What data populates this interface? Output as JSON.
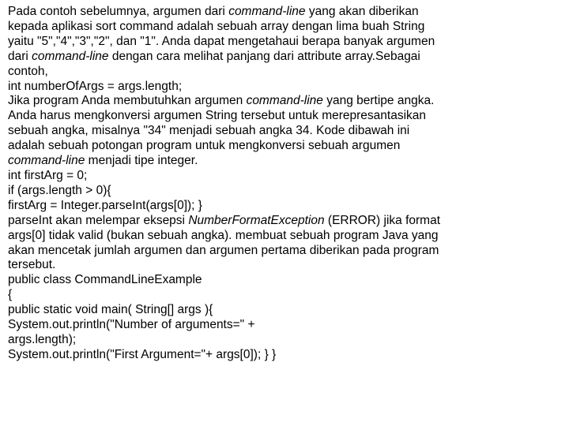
{
  "lines": [
    {
      "t": "p",
      "segments": [
        {
          "text": "Pada contoh sebelumnya, argumen dari "
        },
        {
          "text": "command-line",
          "ital": true
        },
        {
          "text": " yang akan diberikan"
        }
      ]
    },
    {
      "t": "p",
      "segments": [
        {
          "text": "kepada aplikasi sort command adalah sebuah array dengan lima buah String"
        }
      ]
    },
    {
      "t": "p",
      "segments": [
        {
          "text": "yaitu \"5\",\"4\",\"3\",\"2\", dan \"1\". Anda dapat mengetahaui berapa banyak argumen"
        }
      ]
    },
    {
      "t": "p",
      "segments": [
        {
          "text": "dari "
        },
        {
          "text": "command-line",
          "ital": true
        },
        {
          "text": " dengan cara melihat panjang dari attribute array.Sebagai"
        }
      ]
    },
    {
      "t": "p",
      "segments": [
        {
          "text": "contoh,"
        }
      ]
    },
    {
      "t": "p",
      "segments": [
        {
          "text": "int numberOfArgs = args.length;"
        }
      ]
    },
    {
      "t": "p",
      "segments": [
        {
          "text": "Jika program Anda membutuhkan argumen "
        },
        {
          "text": "command-line",
          "ital": true
        },
        {
          "text": " yang bertipe angka."
        }
      ]
    },
    {
      "t": "p",
      "segments": [
        {
          "text": "Anda harus mengkonversi argumen String tersebut untuk merepresantasikan"
        }
      ]
    },
    {
      "t": "p",
      "segments": [
        {
          "text": "sebuah angka, misalnya \"34\" menjadi sebuah angka 34. Kode dibawah ini"
        }
      ]
    },
    {
      "t": "p",
      "segments": [
        {
          "text": "adalah sebuah potongan program untuk mengkonversi sebuah argumen"
        }
      ]
    },
    {
      "t": "p",
      "segments": [
        {
          "text": "command-line",
          "ital": true
        },
        {
          "text": " menjadi tipe integer."
        }
      ]
    },
    {
      "t": "p",
      "segments": [
        {
          "text": "int firstArg = 0;"
        }
      ]
    },
    {
      "t": "p",
      "segments": [
        {
          "text": "if (args.length > 0){"
        }
      ]
    },
    {
      "t": "p",
      "segments": [
        {
          "text": "firstArg = Integer.parseInt(args[0]); }"
        }
      ]
    },
    {
      "t": "p",
      "segments": [
        {
          "text": "parseInt akan melempar eksepsi "
        },
        {
          "text": "NumberFormatException",
          "ital": true
        },
        {
          "text": " (ERROR) jika format"
        }
      ]
    },
    {
      "t": "p",
      "segments": [
        {
          "text": "args[0] tidak valid (bukan sebuah angka). membuat sebuah program Java yang"
        }
      ]
    },
    {
      "t": "p",
      "segments": [
        {
          "text": "akan mencetak jumlah argumen dan argumen pertama diberikan pada program"
        }
      ]
    },
    {
      "t": "p",
      "segments": [
        {
          "text": "tersebut."
        }
      ]
    },
    {
      "t": "p",
      "segments": [
        {
          "text": "public class CommandLineExample"
        }
      ]
    },
    {
      "t": "p",
      "segments": [
        {
          "text": "{"
        }
      ]
    },
    {
      "t": "p",
      "segments": [
        {
          "text": "public static void main( String[] args ){"
        }
      ]
    },
    {
      "t": "p",
      "segments": [
        {
          "text": "System.out.println(\"Number of arguments=\" +"
        }
      ]
    },
    {
      "t": "p",
      "segments": [
        {
          "text": "args.length);"
        }
      ]
    },
    {
      "t": "p",
      "segments": [
        {
          "text": "System.out.println(\"First Argument=\"+ args[0]); } }"
        }
      ]
    }
  ]
}
